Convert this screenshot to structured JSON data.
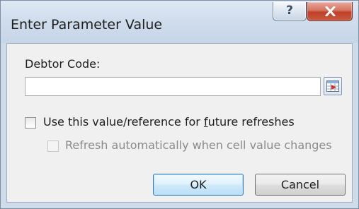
{
  "dialog": {
    "title": "Enter Parameter Value",
    "help_label": "?",
    "close_icon": "close-x-icon"
  },
  "form": {
    "field_label": "Debtor Code:",
    "field_value": "",
    "range_picker_icon": "collapse-dialog-range-icon",
    "future_refresh": {
      "label_before": "Use this value/reference for ",
      "label_access_key": "f",
      "label_after": "uture refreshes",
      "checked": false
    },
    "auto_refresh": {
      "label": "Refresh automatically when cell value changes",
      "checked": false,
      "enabled": false
    }
  },
  "buttons": {
    "ok_label": "OK",
    "cancel_label": "Cancel"
  },
  "colors": {
    "close_button": "#c0402a",
    "ok_button_border": "#3c7fb1",
    "dialog_frame": "#cfdbe9"
  }
}
